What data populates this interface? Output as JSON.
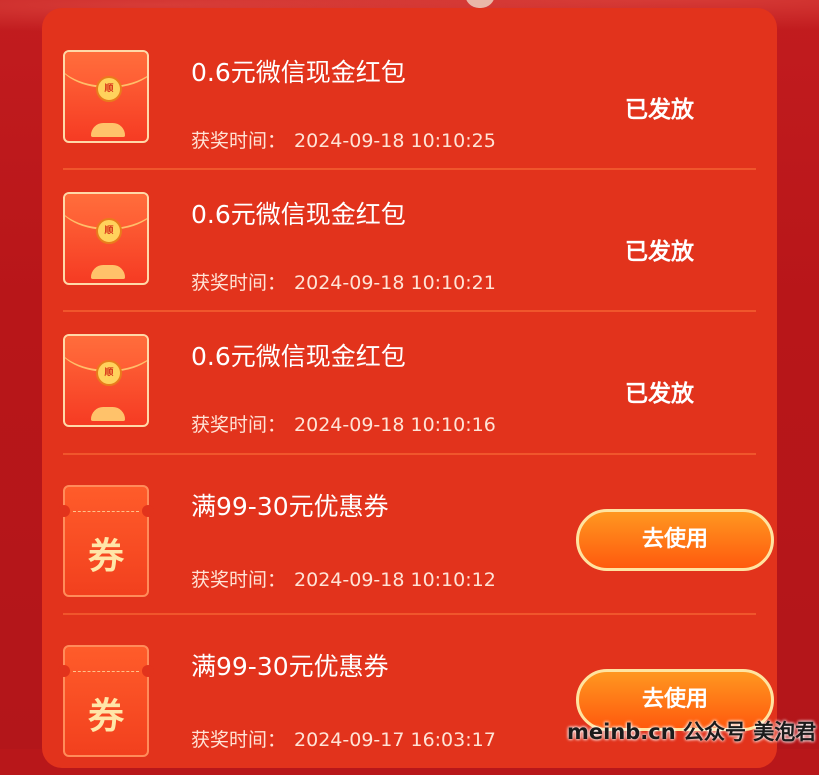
{
  "prizes": [
    {
      "title": "0.6元微信现金红包",
      "time_label": "获奖时间：",
      "time": "2024-09-18 10:10:25",
      "status": "已发放",
      "kind": "envelope"
    },
    {
      "title": "0.6元微信现金红包",
      "time_label": "获奖时间：",
      "time": "2024-09-18 10:10:21",
      "status": "已发放",
      "kind": "envelope"
    },
    {
      "title": "0.6元微信现金红包",
      "time_label": "获奖时间：",
      "time": "2024-09-18 10:10:16",
      "status": "已发放",
      "kind": "envelope"
    },
    {
      "title": "满99-30元优惠券",
      "time_label": "获奖时间：",
      "time": "2024-09-18 10:10:12",
      "action": "去使用",
      "kind": "coupon",
      "coupon_glyph": "券"
    },
    {
      "title": "满99-30元优惠券",
      "time_label": "获奖时间：",
      "time": "2024-09-17 16:03:17",
      "action": "去使用",
      "kind": "coupon",
      "coupon_glyph": "券"
    }
  ],
  "envelope_seal": "顺",
  "watermark": "meinb.cn  公众号 美泡君",
  "colors": {
    "page_bg": "#b8171a",
    "panel": "#e2331c",
    "divider": "#f0562c",
    "button": "#ff6a14",
    "button_border": "#ffe4a0"
  },
  "icons": {
    "envelope": "red-envelope-icon",
    "coupon": "coupon-ticket-icon"
  }
}
